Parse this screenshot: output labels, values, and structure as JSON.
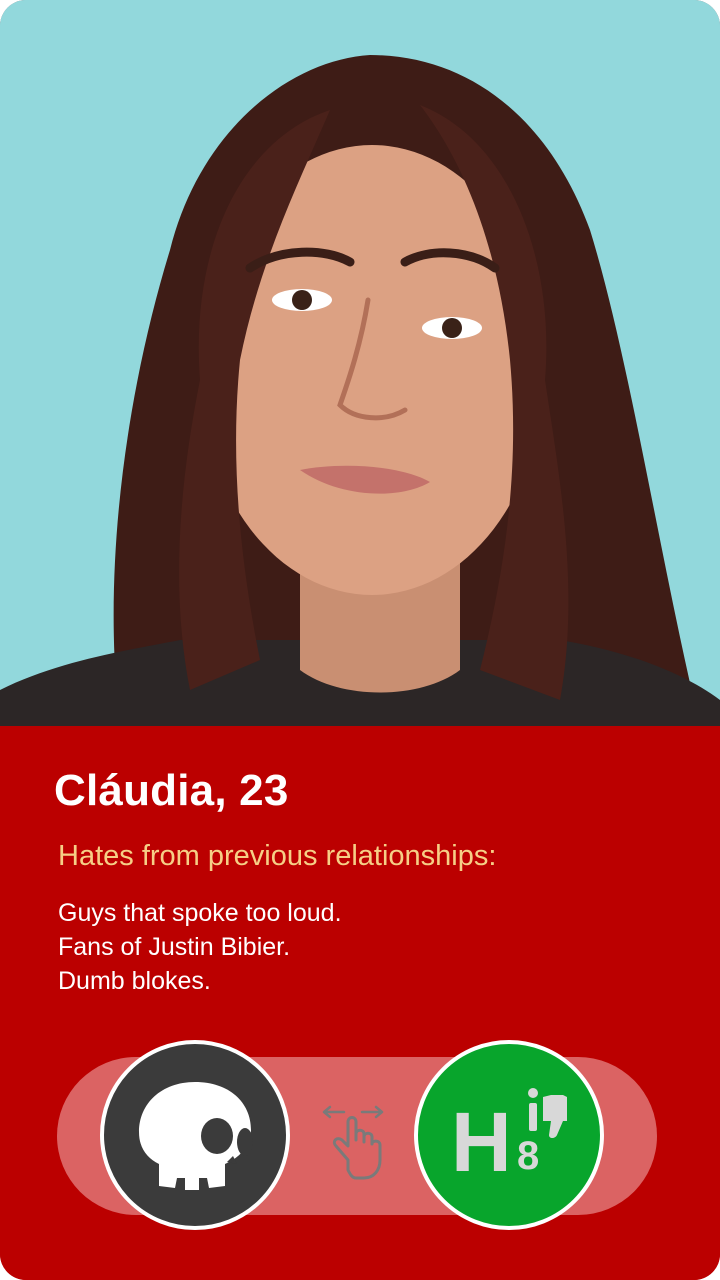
{
  "profile": {
    "name_age": "Cláudia, 23",
    "hates_title": "Hates from previous relationships:",
    "hates": [
      "Guys that spoke too loud.",
      "Fans of Justin Bibier.",
      "Dumb blokes."
    ]
  },
  "actions": {
    "reject_icon": "skull-icon",
    "swipe_hint_icon": "swipe-hand-icon",
    "hate_icon": "h8-thumbs-down-icon",
    "hate_logo_text": "H",
    "hate_logo_digit": "8"
  },
  "colors": {
    "info_panel": "#bb0000",
    "subtitle": "#f6cf86",
    "track": "#db6363",
    "reject_button": "#3b3b3b",
    "hate_button": "#08a52c",
    "photo_background": "#92d8dc"
  }
}
